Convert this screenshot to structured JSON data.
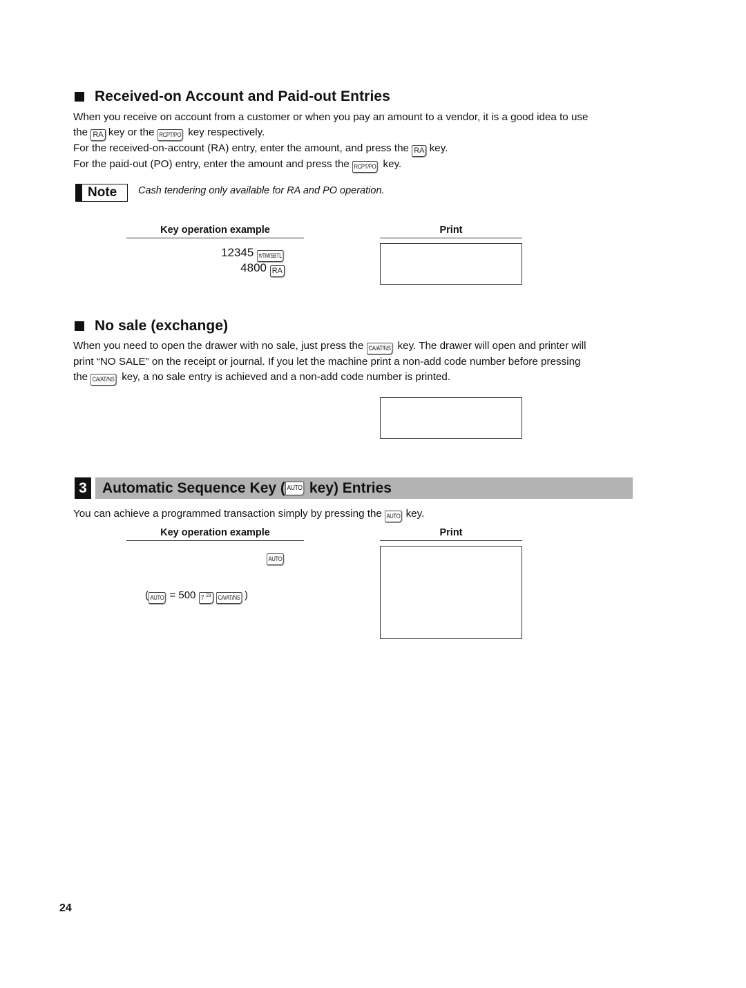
{
  "page_number": "24",
  "section_ra_po": {
    "heading": "Received-on Account and Paid-out Entries",
    "para1_a": "When you receive on account from a customer or when you pay an amount to a vendor, it is a good idea to use",
    "para1_b1": "the ",
    "para1_b2": " key or the ",
    "para1_b3": " key respectively.",
    "para2_a": "For the received-on-account (RA) entry, enter the amount, and press the ",
    "para2_b": " key.",
    "para3_a": "For the paid-out (PO) entry, enter the amount and press the ",
    "para3_b": " key.",
    "note_label": "Note",
    "note_text": "Cash tendering only available for RA and PO operation.",
    "key_operation_header": "Key operation example",
    "print_header": "Print",
    "key_ops": [
      {
        "value": "12345",
        "key": "#/TM/SBTL"
      },
      {
        "value": "4800",
        "key": "RA"
      }
    ]
  },
  "section_no_sale": {
    "heading": "No sale (exchange)",
    "line1_a": "When you need to open the drawer with no sale, just press the ",
    "line1_b": " key.  The drawer will open and printer will",
    "line2": "print “NO SALE” on the receipt or journal.  If you let the machine print a non-add code number before pressing",
    "line3_a": "the ",
    "line3_b": " key, a no sale entry is achieved and a non-add code number is printed."
  },
  "section_auto": {
    "number": "3",
    "heading_a": "Automatic Sequence Key (",
    "heading_b": " key) Entries",
    "intro_a": "You can achieve a programmed transaction simply by pressing the ",
    "intro_b": " key.",
    "key_operation_header": "Key operation example",
    "print_header": "Print",
    "key_op": "AUTO",
    "definition": {
      "open_paren": "(",
      "key_auto": "AUTO",
      "equals": "= 500",
      "key_dept": "7",
      "key_dept_sup": "23",
      "key_ca": "CA/AT/NS",
      "close_paren": ")"
    }
  },
  "keys": {
    "ra": "RA",
    "rcpt_po": "RCPT/PO",
    "ca_at_ns": "CA/AT/NS",
    "auto": "AUTO",
    "tm_sbtl": "#/TM/SBTL"
  }
}
